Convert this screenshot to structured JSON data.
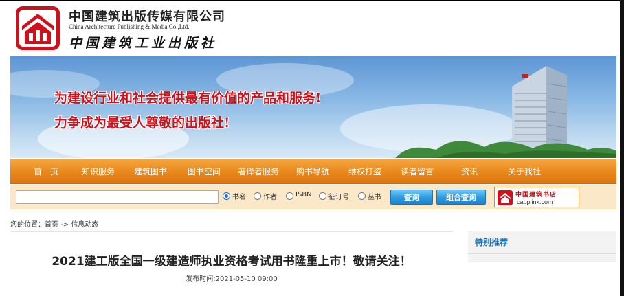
{
  "header": {
    "brand_cn": "中国建筑出版传媒有限公司",
    "brand_en": "China Architecture Publishing & Media Co.,Ltd.",
    "brand_calligraphy": "中国建筑工业出版社",
    "logo_icon": "cabp-logo-icon",
    "logo_color": "#d0101a"
  },
  "banner": {
    "slogan_1": "为建设行业和社会提供最有价值的产品和服务!",
    "slogan_2": "力争成为最受人尊敬的出版社!",
    "slogan_color": "#d0101a"
  },
  "nav": {
    "items": [
      {
        "label": "首　页"
      },
      {
        "label": "知识服务"
      },
      {
        "label": "建筑图书"
      },
      {
        "label": "图书空间"
      },
      {
        "label": "著译者服务"
      },
      {
        "label": "购书导航"
      },
      {
        "label": "维权打盗"
      },
      {
        "label": "读者留言"
      },
      {
        "label": "资讯"
      },
      {
        "label": "关于我社"
      }
    ],
    "bg_color": "#e8871a"
  },
  "search": {
    "input_value": "",
    "options": [
      {
        "label": "书名",
        "selected": true
      },
      {
        "label": "作者",
        "selected": false
      },
      {
        "label": "ISBN",
        "selected": false
      },
      {
        "label": "征订号",
        "selected": false
      },
      {
        "label": "丛书",
        "selected": false
      }
    ],
    "search_button": "查询",
    "combo_button": "组合查询",
    "partner_name": "中国建筑书店",
    "partner_url": "cabplink.com"
  },
  "breadcrumb": {
    "prefix": "您的位置：",
    "home": "首页",
    "separator": "->",
    "current": "信息动态"
  },
  "article": {
    "title": "2021建工版全国一级建造师执业资格考试用书隆重上市！敬请关注！",
    "publish_label": "发布时间:",
    "publish_time": "2021-05-10 09:00"
  },
  "sidebar": {
    "title": "特别推荐"
  }
}
